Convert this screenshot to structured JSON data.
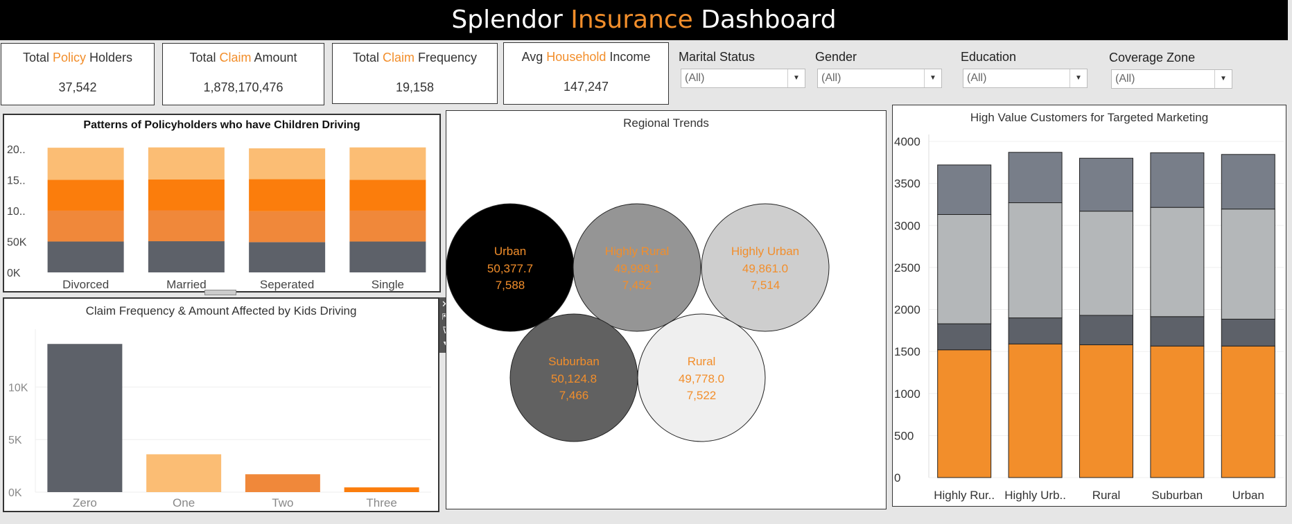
{
  "header": {
    "title_part1": "Splendor ",
    "title_accent": "Insurance",
    "title_part2": " Dashboard"
  },
  "kpis": [
    {
      "pre": "Total ",
      "accent": "Policy",
      "post": " Holders",
      "value": "37,542"
    },
    {
      "pre": "Total ",
      "accent": "Claim",
      "post": " Amount",
      "value": "1,878,170,476"
    },
    {
      "pre": "Total ",
      "accent": "Claim",
      "post": " Frequency",
      "value": "19,158"
    },
    {
      "pre": "Avg ",
      "accent": "Household",
      "post": " Income",
      "value": "147,247"
    }
  ],
  "filters": [
    {
      "label": "Marital Status",
      "value": "(All)"
    },
    {
      "label": "Gender",
      "value": "(All)"
    },
    {
      "label": "Education",
      "value": "(All)"
    },
    {
      "label": "Coverage Zone",
      "value": "(All)"
    }
  ],
  "colors": {
    "accent": "#f28e2b",
    "dark_gray": "#5d6169",
    "light_orange": "#fbbd74",
    "mid_orange": "#f0883a",
    "orange": "#fb7d0c"
  },
  "chart_data": [
    {
      "type": "bar",
      "title": "Patterns of Policyholders who have Children Driving",
      "categories": [
        "Divorced",
        "Married",
        "Seperated",
        "Single"
      ],
      "y_tick_labels": [
        "0K",
        "50K",
        "10..",
        "15..",
        "20.."
      ],
      "ylim": [
        0,
        210000
      ],
      "stacked": true,
      "series": [
        {
          "values": [
            50000,
            50500,
            49000,
            50000
          ],
          "color": "#5d6169"
        },
        {
          "values": [
            50000,
            50000,
            50000,
            50000
          ],
          "color": "#f0883a"
        },
        {
          "values": [
            50000,
            50000,
            52000,
            50000
          ],
          "color": "#fb7d0c"
        },
        {
          "values": [
            52000,
            52000,
            50000,
            52500
          ],
          "color": "#fbbd74"
        }
      ]
    },
    {
      "type": "bar",
      "title": "Claim Frequency & Amount Affected by Kids Driving",
      "categories": [
        "Zero",
        "One",
        "Two",
        "Three"
      ],
      "y_tick_labels": [
        "0K",
        "5K",
        "10K"
      ],
      "values": [
        14100,
        3600,
        1700,
        450
      ],
      "colors": [
        "#5d6169",
        "#fbbd74",
        "#f0883a",
        "#fb7d0c"
      ],
      "ylim": [
        0,
        15500
      ]
    },
    {
      "type": "scatter",
      "title": "Regional Trends",
      "points": [
        {
          "label": "Urban",
          "value": "50,377.7",
          "count": "7,588",
          "fill": "#000000"
        },
        {
          "label": "Highly Rural",
          "value": "49,998.1",
          "count": "7,452",
          "fill": "#959595"
        },
        {
          "label": "Highly Urban",
          "value": "49,861.0",
          "count": "7,514",
          "fill": "#cecece"
        },
        {
          "label": "Suburban",
          "value": "50,124.8",
          "count": "7,466",
          "fill": "#616161"
        },
        {
          "label": "Rural",
          "value": "49,778.0",
          "count": "7,522",
          "fill": "#efefef"
        }
      ]
    },
    {
      "type": "bar",
      "title": "High Value Customers for Targeted Marketing",
      "categories": [
        "Highly Rur..",
        "Highly Urb..",
        "Rural",
        "Suburban",
        "Urban"
      ],
      "y_ticks": [
        0,
        500,
        1000,
        1500,
        2000,
        2500,
        3000,
        3500,
        4000
      ],
      "ylim": [
        0,
        4000
      ],
      "stacked": true,
      "series": [
        {
          "values": [
            1520,
            1590,
            1580,
            1565,
            1565
          ],
          "color": "#f28e2b"
        },
        {
          "values": [
            310,
            310,
            350,
            350,
            320
          ],
          "color": "#5d6169"
        },
        {
          "values": [
            1300,
            1370,
            1240,
            1300,
            1310
          ],
          "color": "#b4b7b9"
        },
        {
          "values": [
            590,
            600,
            630,
            650,
            650
          ],
          "color": "#787e89"
        }
      ]
    }
  ]
}
